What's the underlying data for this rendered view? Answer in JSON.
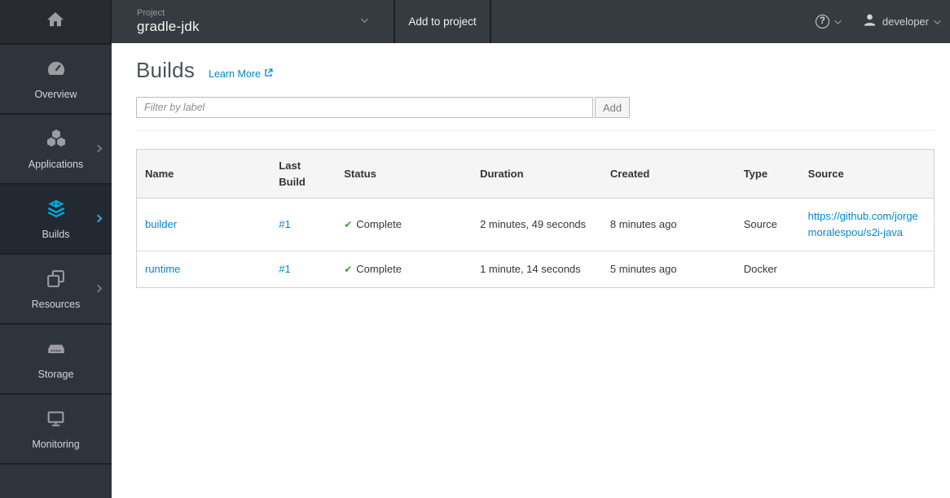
{
  "topbar": {
    "project_label": "Project",
    "project_name": "gradle-jdk",
    "add_to_project_label": "Add to project",
    "user_name": "developer",
    "help_glyph": "?"
  },
  "sidebar": {
    "items": [
      {
        "label": "Overview",
        "icon": "dashboard-icon",
        "has_submenu": false,
        "active": false
      },
      {
        "label": "Applications",
        "icon": "cubes-icon",
        "has_submenu": true,
        "active": false
      },
      {
        "label": "Builds",
        "icon": "builds-icon",
        "has_submenu": true,
        "active": true
      },
      {
        "label": "Resources",
        "icon": "resources-icon",
        "has_submenu": true,
        "active": false
      },
      {
        "label": "Storage",
        "icon": "storage-icon",
        "has_submenu": false,
        "active": false
      },
      {
        "label": "Monitoring",
        "icon": "monitoring-icon",
        "has_submenu": false,
        "active": false
      }
    ]
  },
  "page": {
    "title": "Builds",
    "learn_more_label": "Learn More"
  },
  "filter": {
    "placeholder": "Filter by label",
    "add_button_label": "Add"
  },
  "table": {
    "columns": [
      "Name",
      "Last Build",
      "Status",
      "Duration",
      "Created",
      "Type",
      "Source"
    ],
    "rows": [
      {
        "name": "builder",
        "last_build": "#1",
        "status": "Complete",
        "duration": "2 minutes, 49 seconds",
        "created": "8 minutes ago",
        "type": "Source",
        "source": "https://github.com/jorgemoralespou/s2i-java"
      },
      {
        "name": "runtime",
        "last_build": "#1",
        "status": "Complete",
        "duration": "1 minute, 14 seconds",
        "created": "5 minutes ago",
        "type": "Docker",
        "source": ""
      }
    ]
  },
  "icons": {
    "check": "✔"
  },
  "colors": {
    "link_blue": "#0088ce",
    "success_green": "#3f9c35",
    "builds_accent": "#00a8e0",
    "topbar_bg": "#363b41",
    "sidebar_bg": "#2e343b",
    "active_nav_bg": "#232930",
    "header_row_bg": "#f5f5f5"
  }
}
